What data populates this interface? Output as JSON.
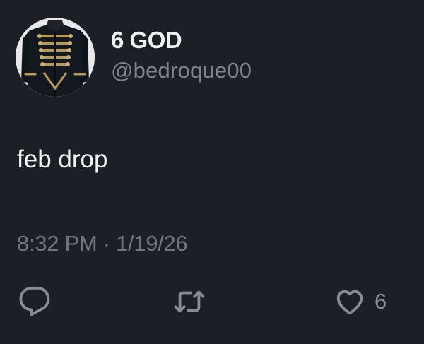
{
  "user": {
    "display_name": "6 GOD",
    "handle": "@bedroque00",
    "avatar_icon": "military-jacket-avatar"
  },
  "tweet": {
    "text": "feb drop",
    "timestamp": "8:32 PM · 1/19/26"
  },
  "actions": {
    "reply_icon": "reply-icon",
    "retweet_icon": "retweet-icon",
    "like_icon": "heart-icon",
    "like_count": "6"
  },
  "colors": {
    "background": "#1c1f26",
    "primary_text": "#e7e9ea",
    "secondary_text": "#7d848c",
    "icon": "#878d94"
  }
}
